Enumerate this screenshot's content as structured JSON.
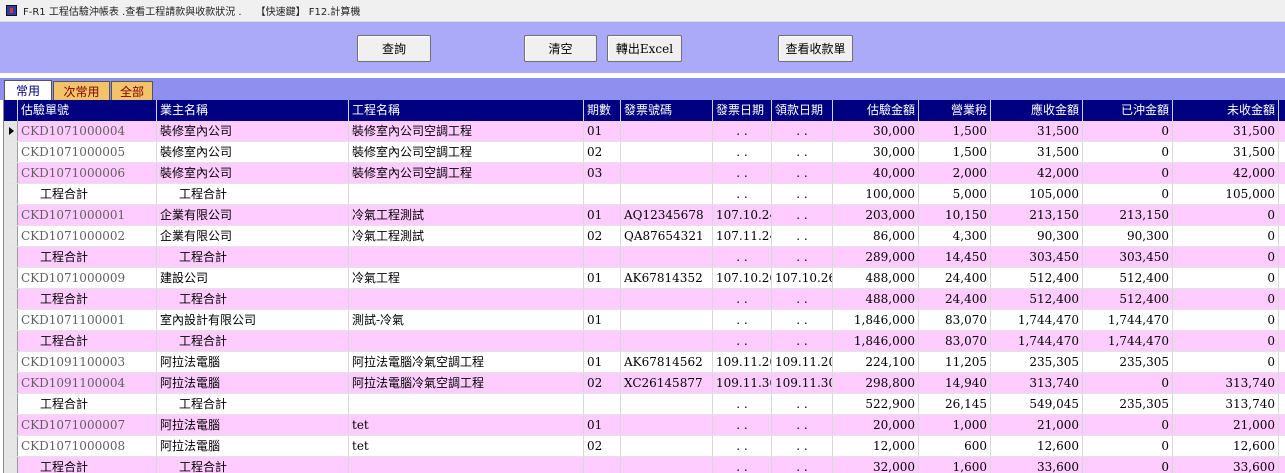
{
  "window": {
    "title": "F-R1 工程估驗沖帳表 .查看工程請款與收款狀況 .",
    "shortcut_label": "【快速鍵】 F12.計算機"
  },
  "toolbar": {
    "query_label": "查詢",
    "clear_label": "清空",
    "export_label": "轉出Excel",
    "view_receipt_label": "查看收款單"
  },
  "tabs": [
    {
      "label": "常用",
      "active": true
    },
    {
      "label": "次常用",
      "active": false
    },
    {
      "label": "全部",
      "active": false
    }
  ],
  "columns": [
    "估驗單號",
    "業主名稱",
    "工程名稱",
    "期數",
    "發票號碼",
    "發票日期",
    "領款日期",
    "估驗金額",
    "營業稅",
    "應收金額",
    "已沖金額",
    "未收金額"
  ],
  "rows": [
    {
      "type": "data",
      "bg": "pink",
      "current": true,
      "cells": [
        "CKD1071000004",
        "裝修室內公司",
        "裝修室內公司空調工程",
        "01",
        "",
        ". .",
        ". .",
        "30,000",
        "1,500",
        "31,500",
        "0",
        "31,500"
      ]
    },
    {
      "type": "data",
      "bg": "white",
      "current": false,
      "cells": [
        "CKD1071000005",
        "裝修室內公司",
        "裝修室內公司空調工程",
        "02",
        "",
        ". .",
        ". .",
        "30,000",
        "1,500",
        "31,500",
        "0",
        "31,500"
      ]
    },
    {
      "type": "data",
      "bg": "pink",
      "current": false,
      "cells": [
        "CKD1071000006",
        "裝修室內公司",
        "裝修室內公司空調工程",
        "03",
        "",
        ". .",
        ". .",
        "40,000",
        "2,000",
        "42,000",
        "0",
        "42,000"
      ]
    },
    {
      "type": "subtotal",
      "bg": "white",
      "current": false,
      "cells": [
        "工程合計",
        "工程合計",
        "",
        "",
        "",
        ". .",
        ". .",
        "100,000",
        "5,000",
        "105,000",
        "0",
        "105,000"
      ]
    },
    {
      "type": "data",
      "bg": "pink",
      "current": false,
      "cells": [
        "CKD1071000001",
        "企業有限公司",
        "冷氣工程測試",
        "01",
        "AQ12345678",
        "107.10.24",
        ". .",
        "203,000",
        "10,150",
        "213,150",
        "213,150",
        "0"
      ]
    },
    {
      "type": "data",
      "bg": "white",
      "current": false,
      "cells": [
        "CKD1071000002",
        "企業有限公司",
        "冷氣工程測試",
        "02",
        "QA87654321",
        "107.11.24",
        ". .",
        "86,000",
        "4,300",
        "90,300",
        "90,300",
        "0"
      ]
    },
    {
      "type": "subtotal",
      "bg": "pink",
      "current": false,
      "cells": [
        "工程合計",
        "工程合計",
        "",
        "",
        "",
        ". .",
        ". .",
        "289,000",
        "14,450",
        "303,450",
        "303,450",
        "0"
      ]
    },
    {
      "type": "data",
      "bg": "white",
      "current": false,
      "cells": [
        "CKD1071000009",
        "建設公司",
        "冷氣工程",
        "01",
        "AK67814352",
        "107.10.26",
        "107.10.26",
        "488,000",
        "24,400",
        "512,400",
        "512,400",
        "0"
      ]
    },
    {
      "type": "subtotal",
      "bg": "pink",
      "current": false,
      "cells": [
        "工程合計",
        "工程合計",
        "",
        "",
        "",
        ". .",
        ". .",
        "488,000",
        "24,400",
        "512,400",
        "512,400",
        "0"
      ]
    },
    {
      "type": "data",
      "bg": "white",
      "current": false,
      "cells": [
        "CKD1071100001",
        "室內設計有限公司",
        "測試-冷氣",
        "01",
        "",
        ". .",
        ". .",
        "1,846,000",
        "83,070",
        "1,744,470",
        "1,744,470",
        "0"
      ]
    },
    {
      "type": "subtotal",
      "bg": "pink",
      "current": false,
      "cells": [
        "工程合計",
        "工程合計",
        "",
        "",
        "",
        ". .",
        ". .",
        "1,846,000",
        "83,070",
        "1,744,470",
        "1,744,470",
        "0"
      ]
    },
    {
      "type": "data",
      "bg": "white",
      "current": false,
      "cells": [
        "CKD1091100003",
        "阿拉法電腦",
        "阿拉法電腦冷氣空調工程",
        "01",
        "AK67814562",
        "109.11.20",
        "109.11.20",
        "224,100",
        "11,205",
        "235,305",
        "235,305",
        "0"
      ]
    },
    {
      "type": "data",
      "bg": "pink",
      "current": false,
      "cells": [
        "CKD1091100004",
        "阿拉法電腦",
        "阿拉法電腦冷氣空調工程",
        "02",
        "XC26145877",
        "109.11.30",
        "109.11.30",
        "298,800",
        "14,940",
        "313,740",
        "0",
        "313,740"
      ]
    },
    {
      "type": "subtotal",
      "bg": "white",
      "current": false,
      "cells": [
        "工程合計",
        "工程合計",
        "",
        "",
        "",
        ". .",
        ". .",
        "522,900",
        "26,145",
        "549,045",
        "235,305",
        "313,740"
      ]
    },
    {
      "type": "data",
      "bg": "pink",
      "current": false,
      "cells": [
        "CKD1071000007",
        "阿拉法電腦",
        "tet",
        "01",
        "",
        ". .",
        ". .",
        "20,000",
        "1,000",
        "21,000",
        "0",
        "21,000"
      ]
    },
    {
      "type": "data",
      "bg": "white",
      "current": false,
      "cells": [
        "CKD1071000008",
        "阿拉法電腦",
        "tet",
        "02",
        "",
        ". .",
        ". .",
        "12,000",
        "600",
        "12,600",
        "0",
        "12,600"
      ]
    },
    {
      "type": "subtotal",
      "bg": "pink",
      "current": false,
      "cells": [
        "工程合計",
        "工程合計",
        "",
        "",
        "",
        ". .",
        ". .",
        "32,000",
        "1,600",
        "33,600",
        "0",
        "33,600"
      ]
    }
  ]
}
